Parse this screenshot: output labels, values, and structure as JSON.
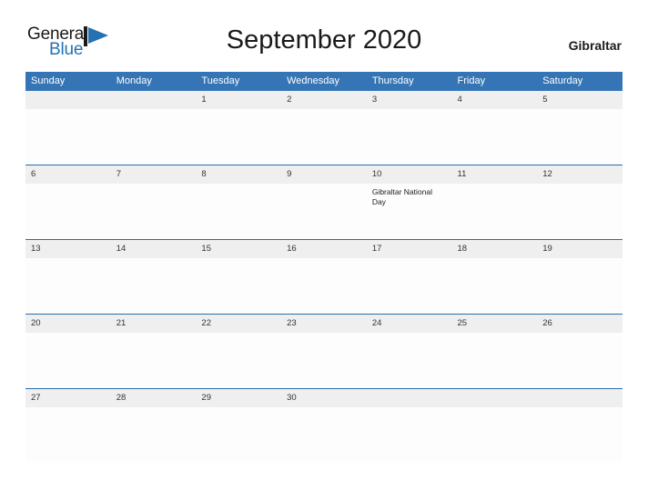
{
  "brand": {
    "name_part1": "General",
    "name_part2": "Blue",
    "mark_icon": "flag-triangle-icon",
    "accent_color": "#2671b4"
  },
  "header": {
    "title": "September 2020",
    "country": "Gibraltar"
  },
  "theme": {
    "header_bar_color": "#3575b5",
    "row_divider_color": "#2a6ca8",
    "date_band_color": "#efefef",
    "cell_background": "#fdfdfd"
  },
  "calendar": {
    "month": "September",
    "year": "2020",
    "weekday_headers": [
      "Sunday",
      "Monday",
      "Tuesday",
      "Wednesday",
      "Thursday",
      "Friday",
      "Saturday"
    ],
    "weeks": [
      [
        {
          "day": "",
          "event": ""
        },
        {
          "day": "",
          "event": ""
        },
        {
          "day": "1",
          "event": ""
        },
        {
          "day": "2",
          "event": ""
        },
        {
          "day": "3",
          "event": ""
        },
        {
          "day": "4",
          "event": ""
        },
        {
          "day": "5",
          "event": ""
        }
      ],
      [
        {
          "day": "6",
          "event": ""
        },
        {
          "day": "7",
          "event": ""
        },
        {
          "day": "8",
          "event": ""
        },
        {
          "day": "9",
          "event": ""
        },
        {
          "day": "10",
          "event": "Gibraltar National Day"
        },
        {
          "day": "11",
          "event": ""
        },
        {
          "day": "12",
          "event": ""
        }
      ],
      [
        {
          "day": "13",
          "event": ""
        },
        {
          "day": "14",
          "event": ""
        },
        {
          "day": "15",
          "event": ""
        },
        {
          "day": "16",
          "event": ""
        },
        {
          "day": "17",
          "event": ""
        },
        {
          "day": "18",
          "event": ""
        },
        {
          "day": "19",
          "event": ""
        }
      ],
      [
        {
          "day": "20",
          "event": ""
        },
        {
          "day": "21",
          "event": ""
        },
        {
          "day": "22",
          "event": ""
        },
        {
          "day": "23",
          "event": ""
        },
        {
          "day": "24",
          "event": ""
        },
        {
          "day": "25",
          "event": ""
        },
        {
          "day": "26",
          "event": ""
        }
      ],
      [
        {
          "day": "27",
          "event": ""
        },
        {
          "day": "28",
          "event": ""
        },
        {
          "day": "29",
          "event": ""
        },
        {
          "day": "30",
          "event": ""
        },
        {
          "day": "",
          "event": ""
        },
        {
          "day": "",
          "event": ""
        },
        {
          "day": "",
          "event": ""
        }
      ]
    ]
  }
}
